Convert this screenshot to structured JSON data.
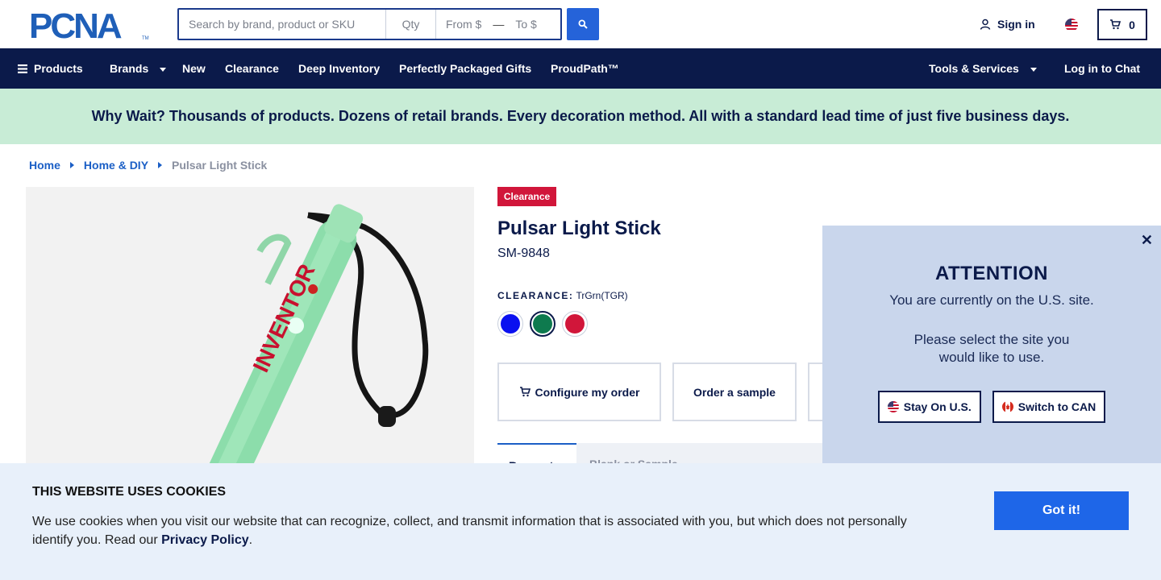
{
  "header": {
    "logo_text": "PCNA",
    "search": {
      "keyword_placeholder": "Search by brand, product or SKU",
      "qty_placeholder": "Qty",
      "from_placeholder": "From $",
      "to_placeholder": "To $"
    },
    "sign_in": "Sign in",
    "cart_count": "0"
  },
  "nav": {
    "products": "Products",
    "brands": "Brands",
    "new": "New",
    "clearance": "Clearance",
    "deep_inventory": "Deep Inventory",
    "gifts": "Perfectly Packaged Gifts",
    "proudpath": "ProudPath™",
    "tools": "Tools & Services",
    "chat": "Log in to Chat"
  },
  "promo": "Why Wait? Thousands of products. Dozens of retail brands. Every decoration method. All with a standard lead time of just five business days.",
  "breadcrumb": [
    "Home",
    "Home & DIY",
    "Pulsar Light Stick"
  ],
  "product": {
    "badge": "Clearance",
    "title": "Pulsar Light Stick",
    "sku": "SM-9848",
    "color_label": "CLEARANCE:",
    "color_value": "TrGrn(TGR)",
    "swatches": [
      {
        "name": "blue",
        "color": "#0a10f0"
      },
      {
        "name": "green",
        "color": "#0e7a4e",
        "selected": true
      },
      {
        "name": "red",
        "color": "#d1163a"
      }
    ],
    "image_text": "INVENTOR",
    "actions": {
      "configure": "Configure my order",
      "sample": "Order a sample"
    },
    "tabs": [
      "Request",
      "Blank or Sample"
    ]
  },
  "attention": {
    "title": "ATTENTION",
    "line1": "You are currently on the U.S. site.",
    "line2": "Please select the site you would like to use.",
    "stay": "Stay On U.S.",
    "switch": "Switch to CAN"
  },
  "cookie": {
    "title": "THIS WEBSITE USES COOKIES",
    "text": "We use cookies when you visit our website that can recognize, collect, and transmit information that is associated with you, but which does not personally identify you. Read our",
    "link": "Privacy Policy",
    "end": ".",
    "button": "Got it!"
  },
  "colors": {
    "navy": "#0b1a4a",
    "link_blue": "#1b5fc6",
    "cta_blue": "#1e66e8",
    "promo_green": "#c8ecd6",
    "clearance_red": "#d1163a"
  }
}
